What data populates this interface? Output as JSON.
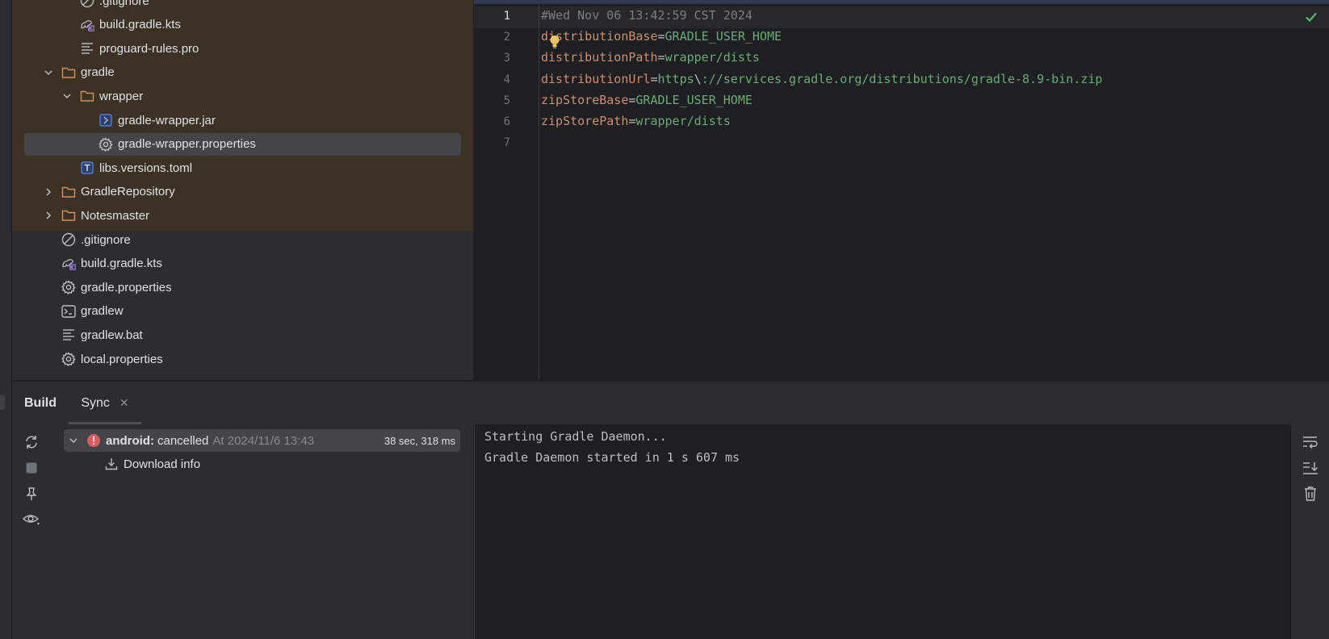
{
  "project_tree": {
    "items": [
      {
        "label": ".gitignore",
        "icon": "ignore-icon",
        "depth": 2,
        "expand": "none",
        "highlighted": true
      },
      {
        "label": "build.gradle.kts",
        "icon": "gradle-kts-icon",
        "depth": 2,
        "expand": "none",
        "highlighted": true
      },
      {
        "label": "proguard-rules.pro",
        "icon": "text-file-icon",
        "depth": 2,
        "expand": "none",
        "highlighted": true
      },
      {
        "label": "gradle",
        "icon": "folder-icon",
        "depth": 1,
        "expand": "open",
        "highlighted": true
      },
      {
        "label": "wrapper",
        "icon": "folder-icon",
        "depth": 2,
        "expand": "open",
        "highlighted": true
      },
      {
        "label": "gradle-wrapper.jar",
        "icon": "jar-icon",
        "depth": 3,
        "expand": "none",
        "highlighted": true
      },
      {
        "label": "gradle-wrapper.properties",
        "icon": "gear-icon",
        "depth": 3,
        "expand": "none",
        "highlighted": true,
        "selected": true
      },
      {
        "label": "libs.versions.toml",
        "icon": "toml-icon",
        "depth": 2,
        "expand": "none",
        "highlighted": true
      },
      {
        "label": "GradleRepository",
        "icon": "folder-icon",
        "depth": 1,
        "expand": "closed",
        "highlighted": true
      },
      {
        "label": "Notesmaster",
        "icon": "folder-icon",
        "depth": 1,
        "expand": "closed",
        "highlighted": true
      },
      {
        "label": ".gitignore",
        "icon": "ignore-icon",
        "depth": 1,
        "expand": "none",
        "highlighted": false
      },
      {
        "label": "build.gradle.kts",
        "icon": "gradle-kts-icon",
        "depth": 1,
        "expand": "none",
        "highlighted": false
      },
      {
        "label": "gradle.properties",
        "icon": "gear-icon",
        "depth": 1,
        "expand": "none",
        "highlighted": false
      },
      {
        "label": "gradlew",
        "icon": "terminal-icon",
        "depth": 1,
        "expand": "none",
        "highlighted": false
      },
      {
        "label": "gradlew.bat",
        "icon": "text-file-icon",
        "depth": 1,
        "expand": "none",
        "highlighted": false
      },
      {
        "label": "local.properties",
        "icon": "gear-icon",
        "depth": 1,
        "expand": "none",
        "highlighted": false
      }
    ]
  },
  "editor": {
    "active_line": 1,
    "lines": [
      {
        "number": "1",
        "comment": "#Wed Nov 06 13:42:59 CST 2024"
      },
      {
        "number": "2",
        "key": "distributionBase",
        "value": "GRADLE_USER_HOME"
      },
      {
        "number": "3",
        "key": "distributionPath",
        "value": "wrapper/dists"
      },
      {
        "number": "4",
        "key": "distributionUrl",
        "value_prefix": "https",
        "escape": "\\",
        "value": "://services.gradle.org/distributions/gradle-8.9-bin.zip"
      },
      {
        "number": "5",
        "key": "zipStoreBase",
        "value": "GRADLE_USER_HOME"
      },
      {
        "number": "6",
        "key": "zipStorePath",
        "value": "wrapper/dists"
      },
      {
        "number": "7"
      }
    ],
    "equals": "=",
    "status_icon": "check-icon",
    "intention_icon": "lightbulb-icon"
  },
  "build_window": {
    "title": "Build",
    "tab": {
      "label": "Sync",
      "close": "✕"
    },
    "tree": {
      "root": {
        "name": "android:",
        "status": "cancelled",
        "time": "At 2024/11/6 13:43",
        "duration": "38 sec, 318 ms"
      },
      "child": {
        "label": "Download info"
      }
    },
    "console": [
      "Starting Gradle Daemon...",
      "Gradle Daemon started in 1 s 607 ms"
    ]
  },
  "colors": {
    "accent_orange": "#cf8e6d",
    "value_green": "#6aab73",
    "error_red": "#db5c5c",
    "folder_orange": "#d4905d",
    "selection": "#43454a"
  }
}
